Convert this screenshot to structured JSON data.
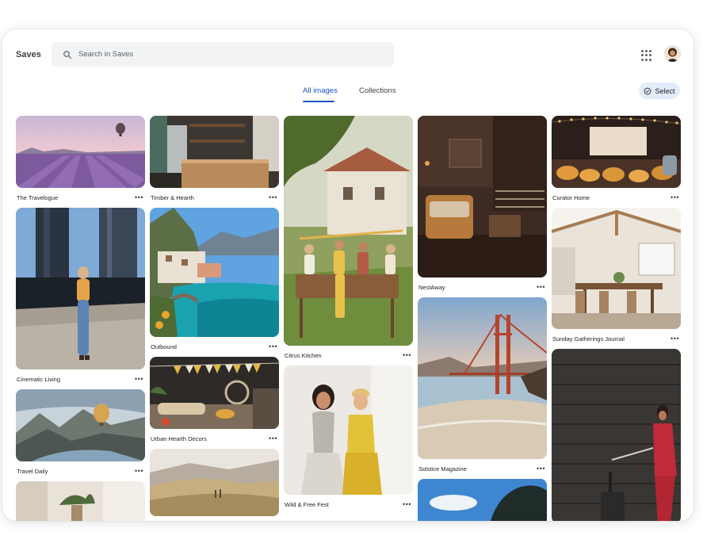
{
  "header": {
    "title": "Saves",
    "search_placeholder": "Search in Saves"
  },
  "tabs": [
    {
      "label": "All images",
      "active": true
    },
    {
      "label": "Collections",
      "active": false
    }
  ],
  "select_label": "Select",
  "more_glyph": "•••",
  "columns": [
    [
      {
        "label": "The Travelogue"
      },
      {
        "label": "Cinematic Living"
      },
      {
        "label": "Travel Daily"
      },
      {
        "label": ""
      }
    ],
    [
      {
        "label": "Timber & Hearth"
      },
      {
        "label": "Outbound"
      },
      {
        "label": "Urban Hearth Decors"
      },
      {
        "label": ""
      }
    ],
    [
      {
        "label": "Citrus Kitchen"
      },
      {
        "label": "Wild & Free Fest"
      }
    ],
    [
      {
        "label": "NestAway"
      },
      {
        "label": "Solstice Magazine"
      },
      {
        "label": ""
      }
    ],
    [
      {
        "label": "Curator Home"
      },
      {
        "label": "Sunday Gatherings Journal"
      },
      {
        "label": ""
      }
    ]
  ],
  "colors": {
    "accent": "#1a56c6",
    "search_bg": "#f1f3f4",
    "select_bg": "#e3ecfa"
  }
}
